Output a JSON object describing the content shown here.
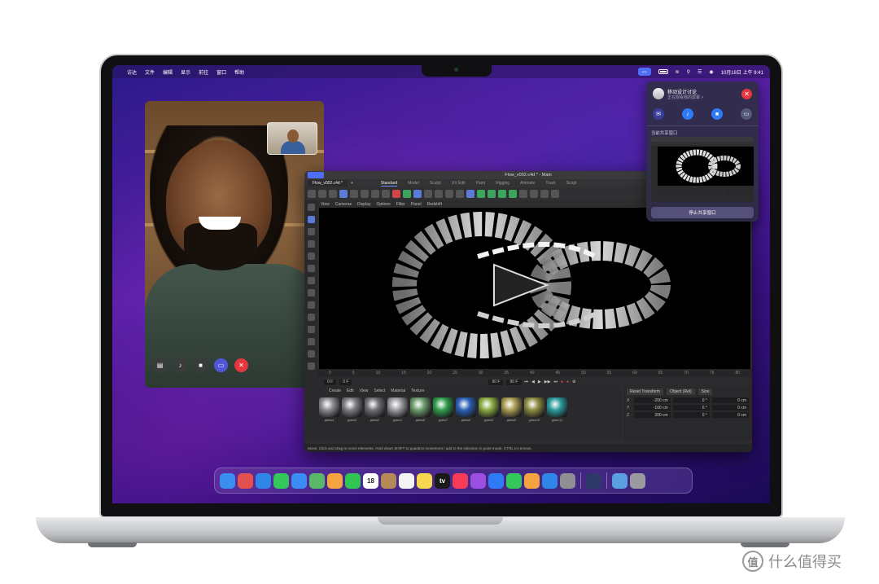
{
  "menubar": {
    "apple": "",
    "items": [
      "访达",
      "文件",
      "编辑",
      "显示",
      "前往",
      "窗口",
      "帮助"
    ],
    "datetime": "10月18日 上午 9:41"
  },
  "facetime": {
    "controls": [
      "sidebar-icon",
      "mic-icon",
      "video-icon",
      "shareplay-icon",
      "end-call-icon"
    ]
  },
  "c4d": {
    "title": "Flow_v002.c4d * - Main",
    "doc_tab": "Flow_v002.c4d *",
    "layouts": [
      "Standard",
      "Model",
      "Sculpt",
      "UV Edit",
      "Paint",
      "Rigging",
      "Animate",
      "Track",
      "Script"
    ],
    "viewport_menu": [
      "View",
      "Cameras",
      "Display",
      "Options",
      "Filter",
      "Panel",
      "Redshift"
    ],
    "timeline_ticks": [
      "0",
      "5",
      "10",
      "15",
      "20",
      "25",
      "30",
      "35",
      "40",
      "45",
      "50",
      "55",
      "60",
      "65",
      "70",
      "75",
      "80",
      "85"
    ],
    "transport_fields": [
      "0 F",
      "0 F",
      "90 F",
      "90 F"
    ],
    "material_menu": [
      "Create",
      "Edit",
      "View",
      "Select",
      "Material",
      "Texture"
    ],
    "materials": [
      {
        "label": "glass4",
        "color": "#8a8a8e"
      },
      {
        "label": "glass3",
        "color": "#7c7c80"
      },
      {
        "label": "glass2",
        "color": "#6f6f73"
      },
      {
        "label": "glass1",
        "color": "#9a9a9e"
      },
      {
        "label": "glass8",
        "color": "#6a9a6a"
      },
      {
        "label": "glass7",
        "color": "#2f9b4a"
      },
      {
        "label": "glass6",
        "color": "#2a5fb5"
      },
      {
        "label": "glass5",
        "color": "#88a840"
      },
      {
        "label": "glass9",
        "color": "#a89a50"
      },
      {
        "label": "glass10",
        "color": "#8a8a40"
      },
      {
        "label": "glass11",
        "color": "#2a9a9a"
      }
    ],
    "attr_tabs": [
      "Reset Transform",
      "Object (Rel)",
      "Size"
    ],
    "attr_rows": [
      {
        "axis": "X",
        "pos": "-200 cm",
        "rot": "0 °",
        "size": "0 cm"
      },
      {
        "axis": "Y",
        "pos": "-100 cm",
        "rot": "0 °",
        "size": "0 cm"
      },
      {
        "axis": "Z",
        "pos": "200 cm",
        "rot": "0 °",
        "size": "0 cm"
      }
    ],
    "status": "Move: Click and drag to move elements. Hold down SHIFT to quantize movement / add to the selection in point mode, CTRL to remove."
  },
  "shareplay": {
    "title": "移动设计讨论",
    "subtitle": "正在观看我的屏幕 >",
    "section": "当前共享窗口",
    "stop_label": "停止共享窗口"
  },
  "dock": {
    "apps": [
      {
        "name": "finder",
        "color": "#3a8ef0",
        "glyph": ""
      },
      {
        "name": "launchpad",
        "color": "#e35050",
        "glyph": ""
      },
      {
        "name": "safari",
        "color": "#2f86e8",
        "glyph": ""
      },
      {
        "name": "messages",
        "color": "#34c759",
        "glyph": ""
      },
      {
        "name": "mail",
        "color": "#3b8cf3",
        "glyph": ""
      },
      {
        "name": "maps",
        "color": "#58b868",
        "glyph": ""
      },
      {
        "name": "photos",
        "color": "#f4a340",
        "glyph": ""
      },
      {
        "name": "facetime",
        "color": "#30c452",
        "glyph": ""
      },
      {
        "name": "calendar",
        "color": "#ffffff",
        "glyph": "18"
      },
      {
        "name": "contacts",
        "color": "#b58a55",
        "glyph": ""
      },
      {
        "name": "reminders",
        "color": "#f4f4f4",
        "glyph": ""
      },
      {
        "name": "notes",
        "color": "#f8d64e",
        "glyph": ""
      },
      {
        "name": "tv",
        "color": "#1a1a1a",
        "glyph": "tv"
      },
      {
        "name": "music",
        "color": "#f53b57",
        "glyph": ""
      },
      {
        "name": "podcasts",
        "color": "#9b4fe0",
        "glyph": ""
      },
      {
        "name": "keynote",
        "color": "#2f7bf6",
        "glyph": ""
      },
      {
        "name": "numbers",
        "color": "#34c759",
        "glyph": ""
      },
      {
        "name": "pages",
        "color": "#f4a340",
        "glyph": ""
      },
      {
        "name": "app-store",
        "color": "#2f86e8",
        "glyph": ""
      },
      {
        "name": "system-preferences",
        "color": "#8e8e93",
        "glyph": ""
      },
      {
        "name": "cinema4d",
        "color": "#2b3a66",
        "glyph": ""
      },
      {
        "name": "downloads",
        "color": "#5aa0e0",
        "glyph": ""
      },
      {
        "name": "trash",
        "color": "#9a9aa0",
        "glyph": ""
      }
    ]
  },
  "watermark": {
    "text": "什么值得买",
    "logo": "值"
  }
}
